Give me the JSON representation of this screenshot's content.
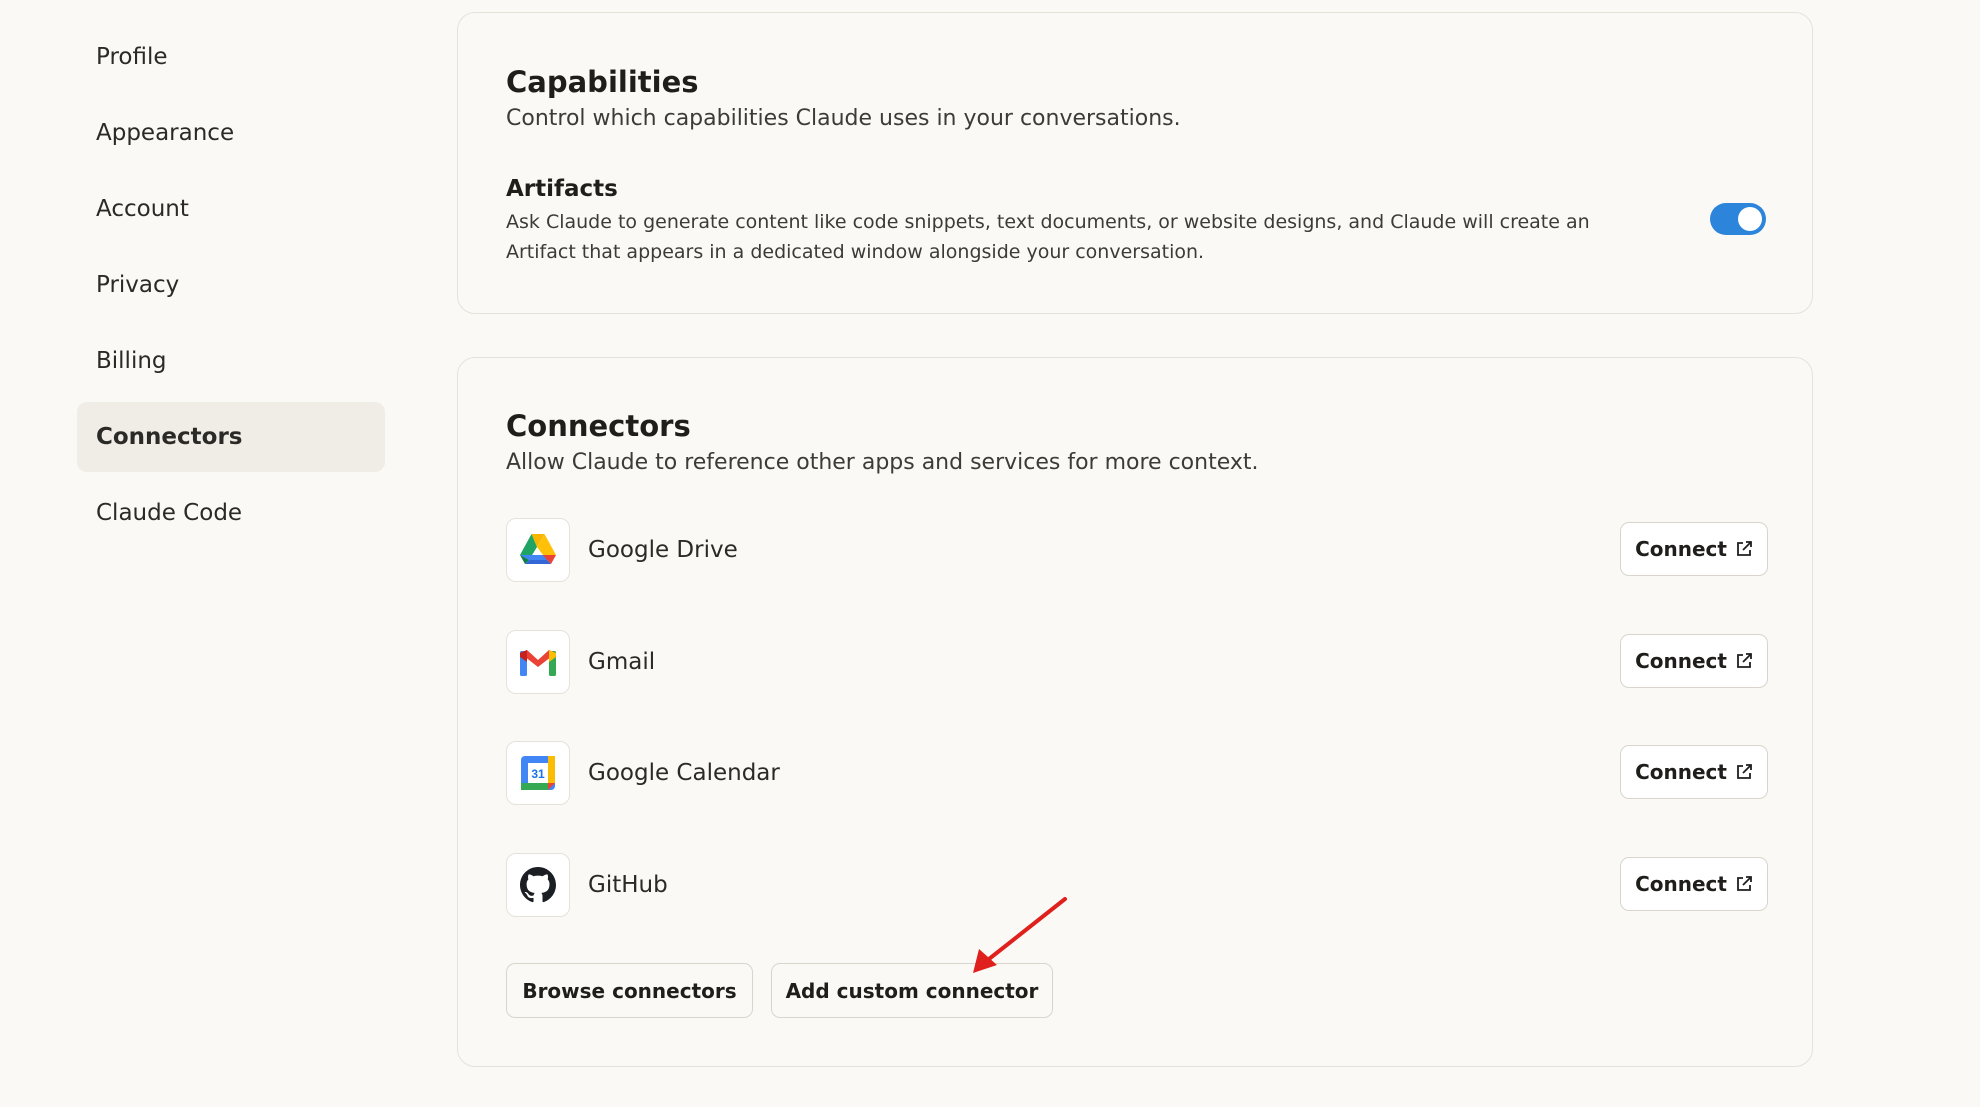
{
  "sidebar": {
    "items": [
      {
        "label": "Profile"
      },
      {
        "label": "Appearance"
      },
      {
        "label": "Account"
      },
      {
        "label": "Privacy"
      },
      {
        "label": "Billing"
      },
      {
        "label": "Connectors",
        "active": true
      },
      {
        "label": "Claude Code"
      }
    ]
  },
  "capabilities": {
    "title": "Capabilities",
    "subtitle": "Control which capabilities Claude uses in your conversations.",
    "artifacts": {
      "title": "Artifacts",
      "description": "Ask Claude to generate content like code snippets, text documents, or website designs, and Claude will create an Artifact that appears in a dedicated window alongside your conversation.",
      "enabled": true
    }
  },
  "connectors": {
    "title": "Connectors",
    "subtitle": "Allow Claude to reference other apps and services for more context.",
    "items": [
      {
        "name": "Google Drive",
        "icon": "google-drive-icon",
        "button": "Connect"
      },
      {
        "name": "Gmail",
        "icon": "gmail-icon",
        "button": "Connect"
      },
      {
        "name": "Google Calendar",
        "icon": "google-calendar-icon",
        "button": "Connect",
        "icon_text": "31"
      },
      {
        "name": "GitHub",
        "icon": "github-icon",
        "button": "Connect"
      }
    ],
    "browse_label": "Browse connectors",
    "add_custom_label": "Add custom connector"
  },
  "colors": {
    "accent": "#2c84db",
    "annotation_arrow": "#e0201c"
  }
}
